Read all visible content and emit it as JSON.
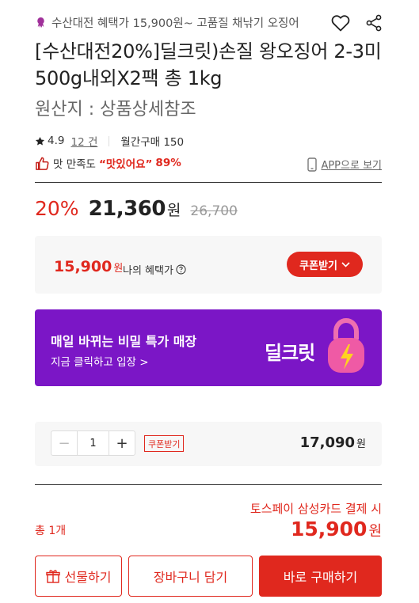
{
  "header": {
    "promo_text": "수산대전 혜택가 15,900원~ 고품질 채낚기 오징어",
    "icons": [
      "squid-icon",
      "heart-icon",
      "share-icon"
    ]
  },
  "product": {
    "title": "[수산대전20%]딜크릿)손질 왕오징어 2-3미 500g내외X2팩 총 1kg",
    "origin": "원산지 : 상품상세참조"
  },
  "rating": {
    "score": "4.9",
    "review_count": "12 건",
    "monthly_purchase": "월간구매 150"
  },
  "taste": {
    "label": "맛 만족도",
    "value": "“맛있어요”",
    "percent": "89%",
    "app_link": "APP으로 보기"
  },
  "price": {
    "discount": "20%",
    "sale_price": "21,360",
    "won": "원",
    "original_price": "26,700"
  },
  "benefit": {
    "price": "15,900",
    "won": "원",
    "label": "나의 혜택가",
    "coupon_button": "쿠폰받기"
  },
  "banner": {
    "title": "매일 바뀌는 비밀 특가 매장",
    "subtitle": "지금 클릭하고 입장 >",
    "logo": "딜크릿"
  },
  "quantity": {
    "minus": "−",
    "value": "1",
    "plus": "+",
    "coupon_tag": "쿠폰받기",
    "price": "17,090",
    "won": "원"
  },
  "summary": {
    "card_note": "토스페이 삼성카드 결제 시",
    "total_label": "총 1개",
    "total_price": "15,900",
    "won": "원"
  },
  "actions": {
    "gift": "선물하기",
    "cart": "장바구니 담기",
    "buy": "바로 구매하기"
  },
  "colors": {
    "accent": "#e0281e",
    "banner": "#7b16c6",
    "box_bg": "#f7f7f7"
  }
}
